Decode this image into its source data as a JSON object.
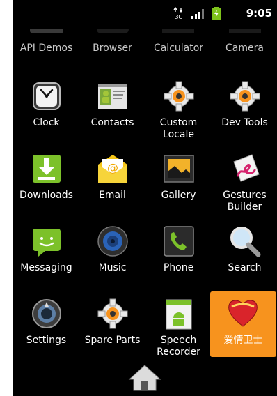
{
  "status": {
    "network": "3G",
    "time": "9:05"
  },
  "top_row": [
    "API Demos",
    "Browser",
    "Calculator",
    "Camera"
  ],
  "apps": [
    {
      "label": "Clock",
      "icon": "clock-icon"
    },
    {
      "label": "Contacts",
      "icon": "contacts-icon"
    },
    {
      "label": "Custom Locale",
      "icon": "gear-icon"
    },
    {
      "label": "Dev Tools",
      "icon": "gear-icon"
    },
    {
      "label": "Downloads",
      "icon": "download-icon"
    },
    {
      "label": "Email",
      "icon": "email-icon"
    },
    {
      "label": "Gallery",
      "icon": "gallery-icon"
    },
    {
      "label": "Gestures Builder",
      "icon": "gestures-icon"
    },
    {
      "label": "Messaging",
      "icon": "messaging-icon"
    },
    {
      "label": "Music",
      "icon": "music-icon"
    },
    {
      "label": "Phone",
      "icon": "phone-icon"
    },
    {
      "label": "Search",
      "icon": "search-icon"
    },
    {
      "label": "Settings",
      "icon": "settings-icon"
    },
    {
      "label": "Spare Parts",
      "icon": "gear-icon"
    },
    {
      "label": "Speech Recorder",
      "icon": "android-icon"
    },
    {
      "label": "爱情卫士",
      "icon": "heart-icon"
    }
  ],
  "colors": {
    "background": "#000000",
    "highlight": "#f7931e",
    "text": "#ffffff"
  }
}
